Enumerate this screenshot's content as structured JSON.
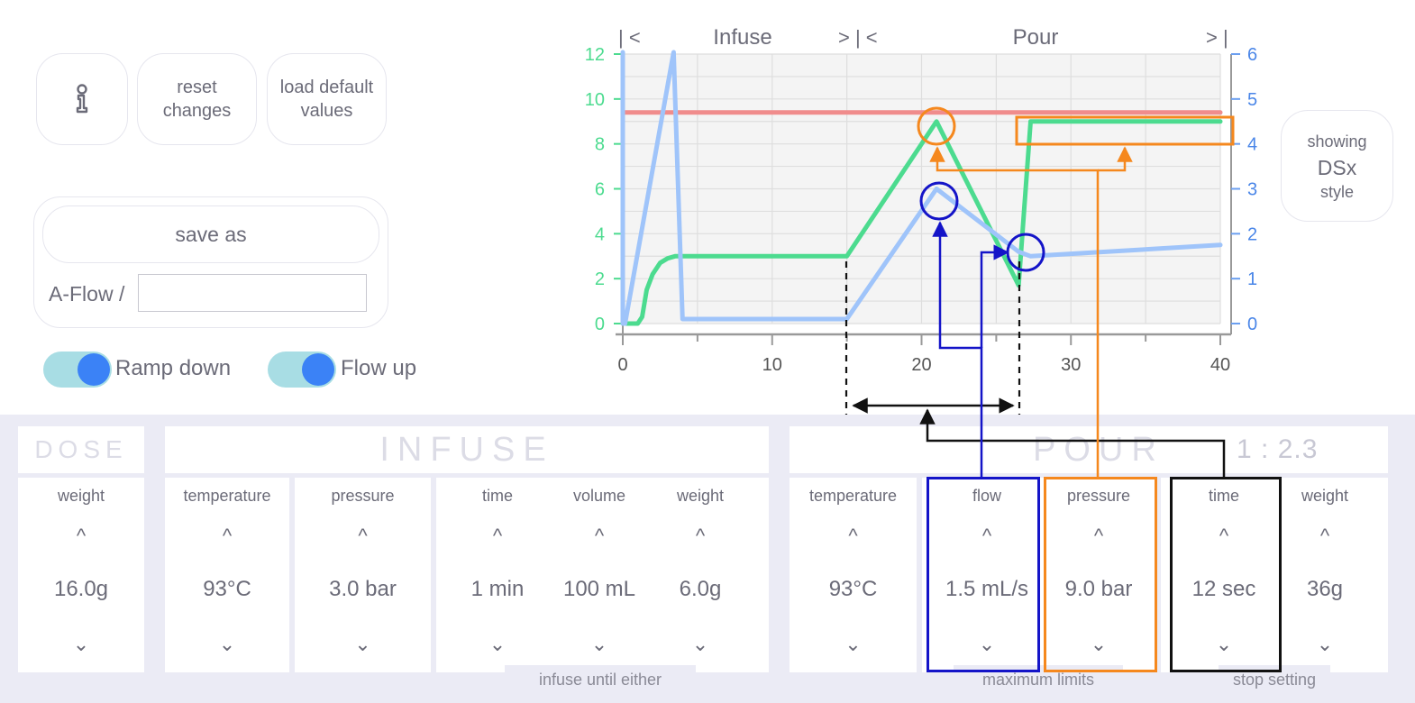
{
  "controls": {
    "info_icon": "info-icon",
    "reset_label": "reset\nchanges",
    "load_default_label": "load default\nvalues",
    "save_as_label": "save as",
    "name_prefix": "A-Flow /",
    "name_value": "",
    "toggle_ramp_label": "Ramp down",
    "toggle_flow_label": "Flow up",
    "style_top": "showing",
    "style_mid": "DSx",
    "style_bot": "style"
  },
  "chart": {
    "phase_infuse_start": "| <",
    "phase_infuse_label": "Infuse",
    "phase_infuse_end": "> | <",
    "phase_pour_label": "Pour",
    "phase_pour_end": "> |"
  },
  "chart_data": {
    "type": "line",
    "xlim": [
      0,
      40
    ],
    "ylim_left": [
      0,
      12
    ],
    "ylim_right": [
      0,
      6
    ],
    "x_ticks": [
      "0",
      "10",
      "20",
      "30",
      "40"
    ],
    "y_left_ticks": [
      "0",
      "2",
      "4",
      "6",
      "8",
      "10",
      "12"
    ],
    "y_right_ticks": [
      "0",
      "1",
      "2",
      "3",
      "4",
      "5",
      "6"
    ],
    "grid": true,
    "series": [
      {
        "color": "#f08c8c",
        "axis": "left",
        "x": [
          0,
          40
        ],
        "y": [
          9.4,
          9.4
        ]
      },
      {
        "color": "#4cdb8f",
        "axis": "left",
        "x": [
          0,
          1,
          1.3,
          1.6,
          2,
          2.5,
          3,
          3.5,
          4,
          15,
          21,
          26.5,
          27.3,
          28,
          40
        ],
        "y": [
          0,
          0,
          0.3,
          1.5,
          2.2,
          2.7,
          2.9,
          3,
          3,
          3,
          9,
          1.7,
          9,
          9,
          9
        ]
      },
      {
        "color": "#9fc4fa",
        "axis": "right",
        "x": [
          0,
          0,
          0.15,
          3.4,
          4,
          15,
          21,
          26.5,
          27.3,
          40
        ],
        "y": [
          6.3,
          0,
          0,
          6.3,
          0.1,
          0.1,
          3.0,
          1.6,
          1.5,
          1.75
        ]
      }
    ]
  },
  "dose": {
    "title": "DOSE",
    "weight": {
      "label": "weight",
      "value": "16.0g"
    }
  },
  "infuse": {
    "title": "INFUSE",
    "temperature": {
      "label": "temperature",
      "value": "93°C"
    },
    "pressure": {
      "label": "pressure",
      "value": "3.0 bar"
    },
    "time": {
      "label": "time",
      "value": "1 min"
    },
    "volume": {
      "label": "volume",
      "value": "100 mL"
    },
    "weight": {
      "label": "weight",
      "value": "6.0g"
    },
    "footer": "infuse until either"
  },
  "pour": {
    "title": "POUR",
    "ratio": "1 : 2.3",
    "temperature": {
      "label": "temperature",
      "value": "93°C"
    },
    "flow": {
      "label": "flow",
      "value": "1.5 mL/s"
    },
    "pressure": {
      "label": "pressure",
      "value": "9.0 bar"
    },
    "time": {
      "label": "time",
      "value": "12 sec"
    },
    "weight": {
      "label": "weight",
      "value": "36g"
    },
    "footer_limits": "maximum limits",
    "footer_stop": "stop setting"
  },
  "arrows": {
    "up": "^",
    "down": "⌄"
  },
  "colors": {
    "accent_blue": "#1414c8",
    "accent_orange": "#f5881e",
    "pressure_green": "#4cdb8f",
    "flow_blue": "#9fc4fa",
    "target_red": "#f08c8c",
    "toggle_track": "#a8dde4",
    "toggle_knob": "#3b82f6"
  }
}
